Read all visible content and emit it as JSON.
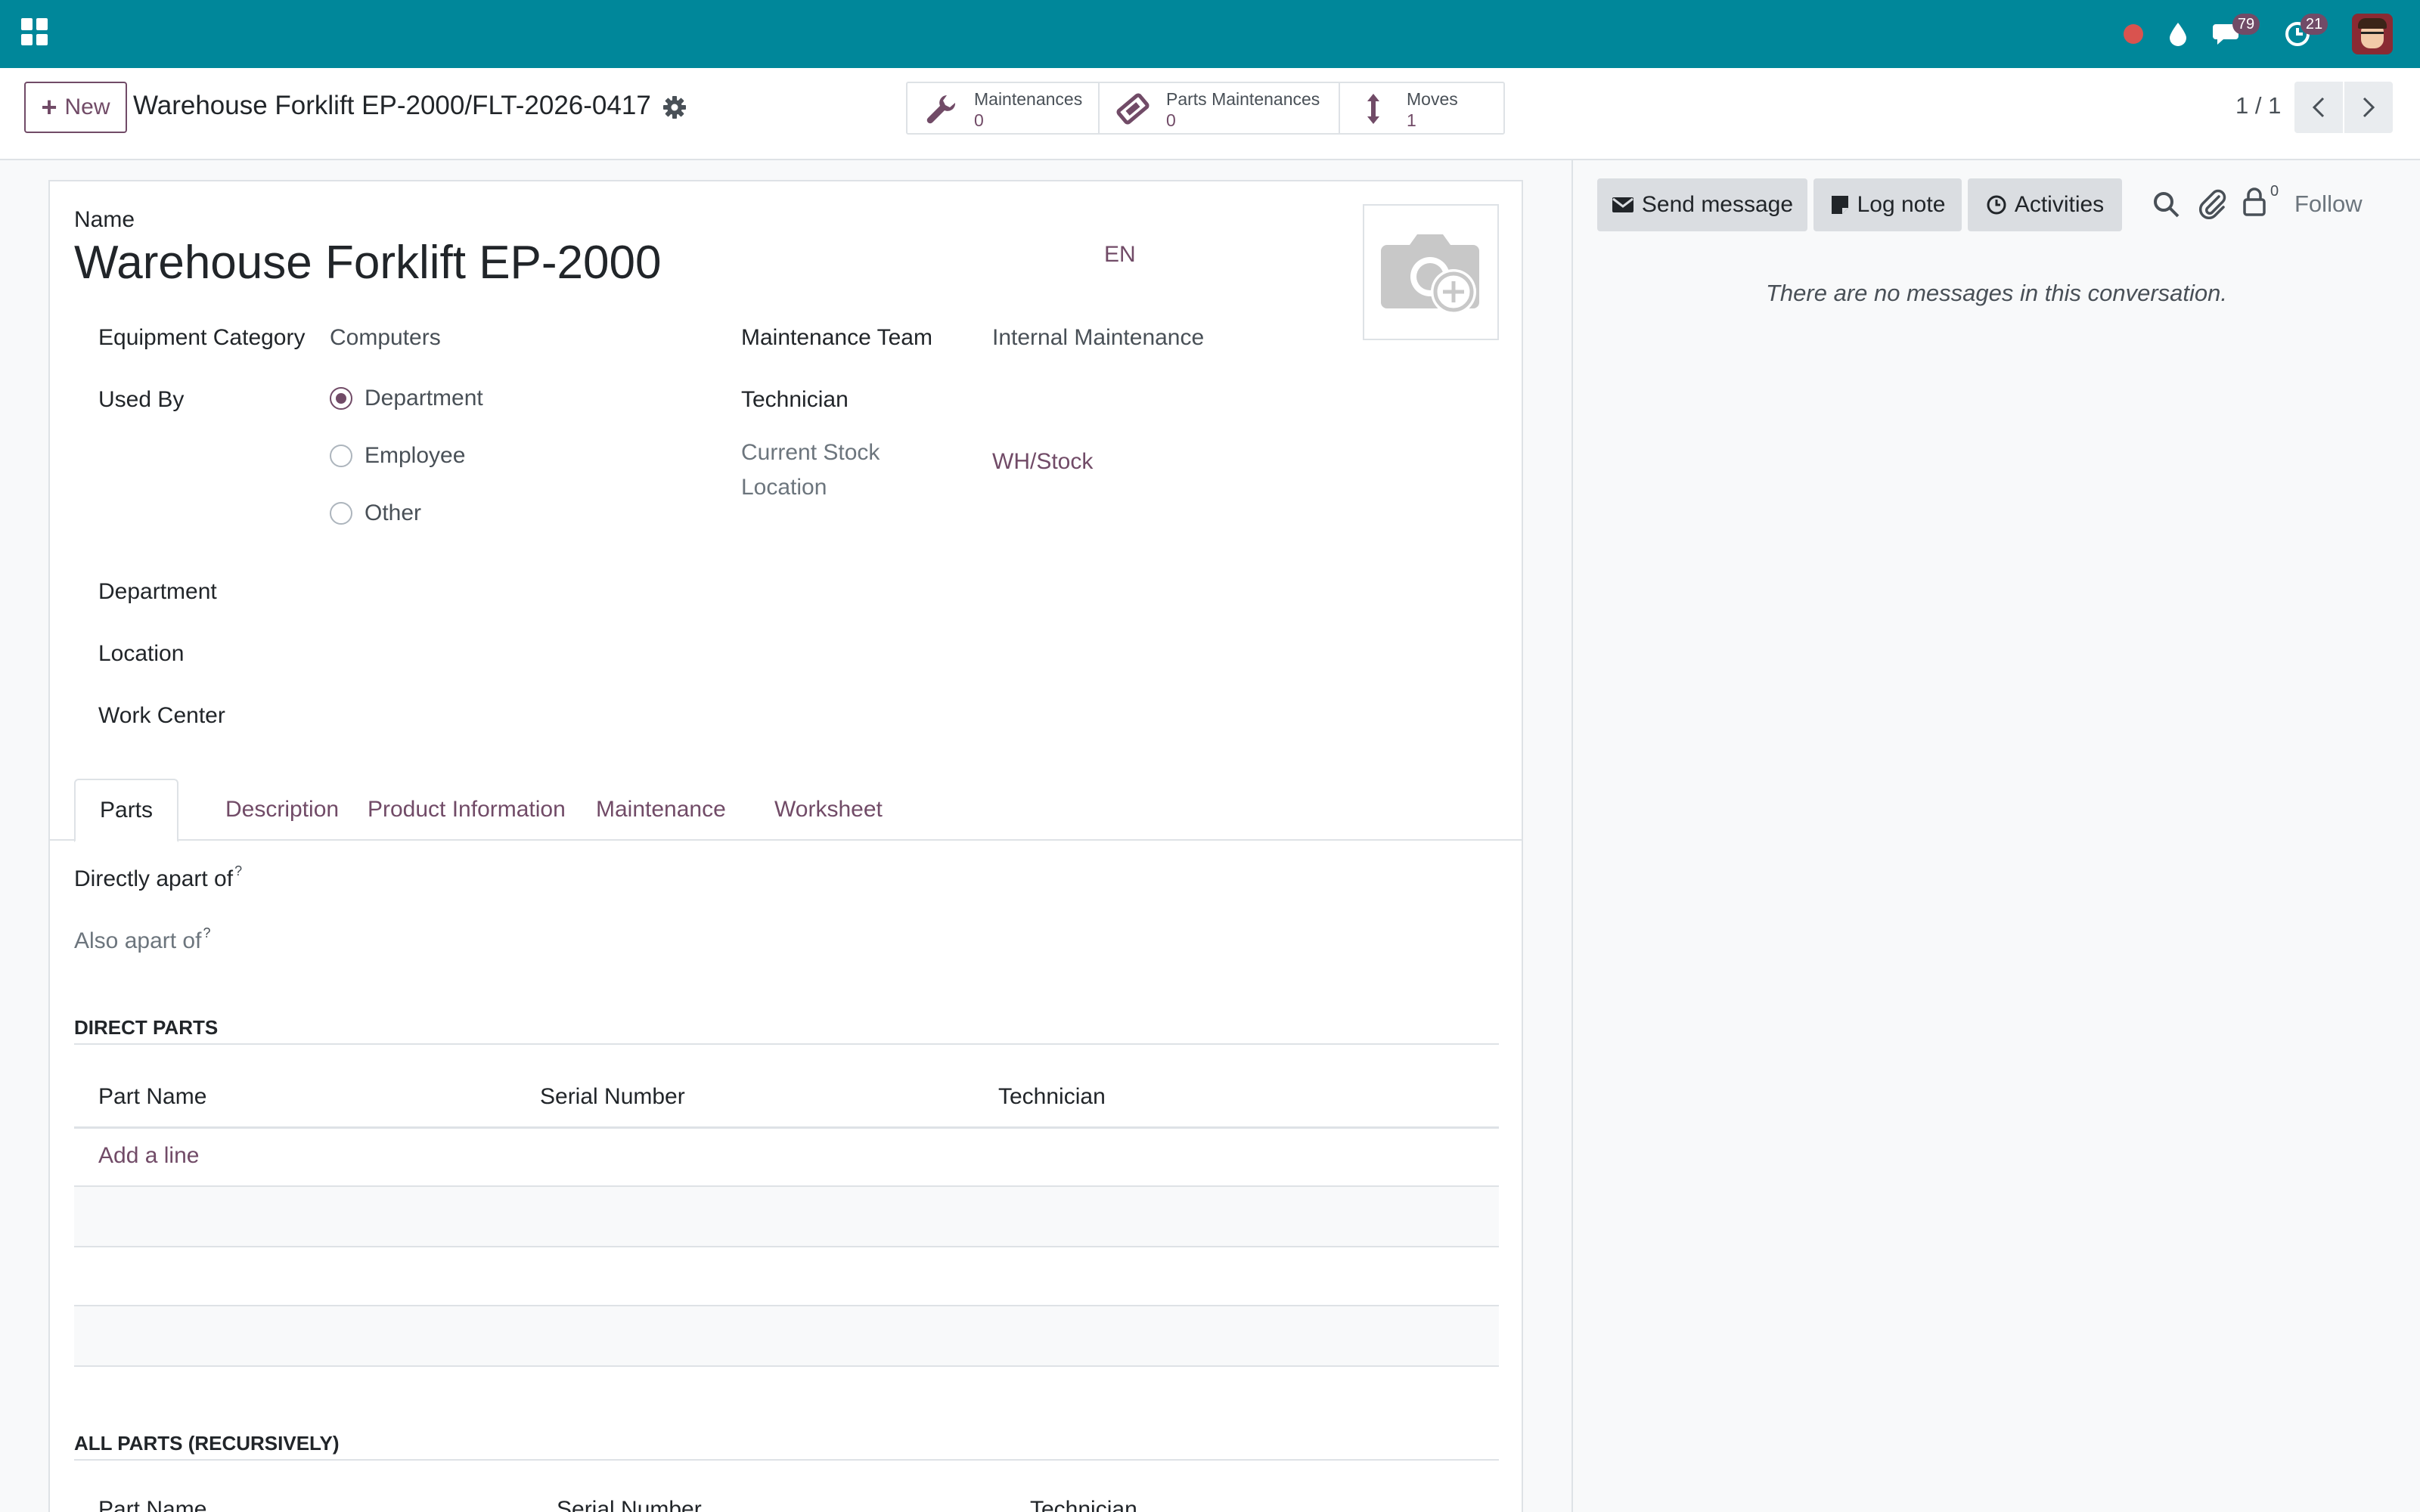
{
  "navbar": {
    "badges": {
      "messages": "79",
      "activities": "21"
    },
    "brand_color": "#00879a"
  },
  "control_panel": {
    "new_label": "New",
    "title": "Warehouse Forklift EP-2000/FLT-2026-0417",
    "smart_buttons": [
      {
        "label": "Maintenances",
        "count": "0",
        "icon": "wrench-icon"
      },
      {
        "label": "Parts Maintenances",
        "count": "0",
        "icon": "ticket-icon"
      },
      {
        "label": "Moves",
        "count": "1",
        "icon": "vertical-arrows-icon"
      }
    ],
    "pager": "1 / 1"
  },
  "form": {
    "name_label": "Name",
    "name_value": "Warehouse Forklift EP-2000",
    "lang": "EN",
    "left_fields": {
      "category_label": "Equipment Category",
      "category_value": "Computers",
      "used_by_label": "Used By",
      "used_by_options": [
        "Department",
        "Employee",
        "Other"
      ],
      "used_by_selected": "Department",
      "department_label": "Department",
      "location_label": "Location",
      "work_center_label": "Work Center"
    },
    "right_fields": {
      "team_label": "Maintenance Team",
      "team_value": "Internal Maintenance",
      "technician_label": "Technician",
      "stock_location_label": "Current Stock Location",
      "stock_location_value": "WH/Stock"
    },
    "tabs": [
      "Parts",
      "Description",
      "Product Information",
      "Maintenance",
      "Worksheet"
    ],
    "active_tab": "Parts",
    "parts": {
      "directly_apart_label": "Directly apart of",
      "also_apart_label": "Also apart of",
      "tooltip_mark": "?",
      "direct_parts_title": "DIRECT PARTS",
      "columns": [
        "Part Name",
        "Serial Number",
        "Technician"
      ],
      "add_line": "Add a line",
      "all_parts_title": "ALL PARTS (RECURSIVELY)"
    }
  },
  "chatter": {
    "send_message": "Send message",
    "log_note": "Log note",
    "activities": "Activities",
    "followers_count": "0",
    "follow": "Follow",
    "empty_text": "There are no messages in this conversation."
  }
}
